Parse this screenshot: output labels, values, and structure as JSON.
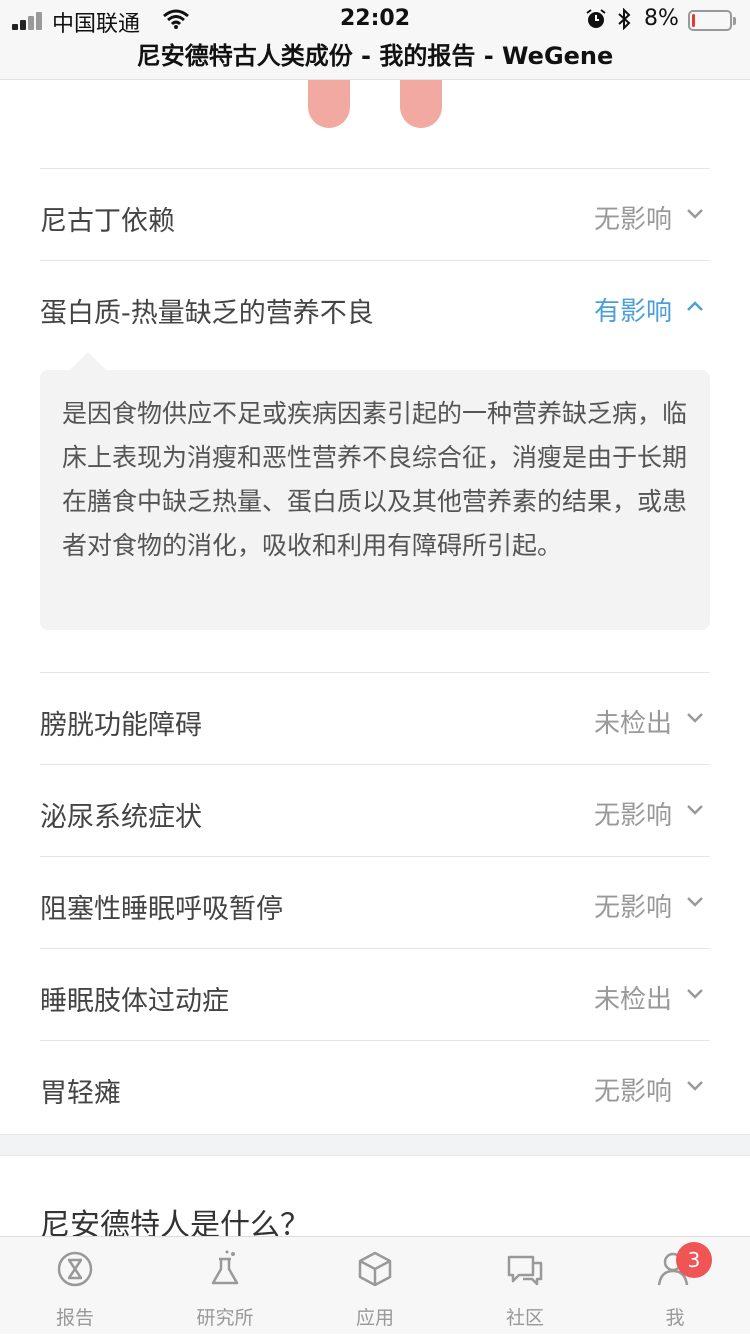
{
  "status_bar": {
    "carrier": "中国联通",
    "time": "22:02",
    "battery_percent": "8%",
    "battery_level": 0.08
  },
  "header": {
    "title": "尼安德特古人类成份 - 我的报告 - WeGene"
  },
  "items": [
    {
      "label": "尼古丁依赖",
      "status": "无影响",
      "expanded": false
    },
    {
      "label": "蛋白质-热量缺乏的营养不良",
      "status": "有影响",
      "expanded": true,
      "description": "是因食物供应不足或疾病因素引起的一种营养缺乏病，临床上表现为消瘦和恶性营养不良综合征，消瘦是由于长期在膳食中缺乏热量、蛋白质以及其他营养素的结果，或患者对食物的消化，吸收和利用有障碍所引起。"
    },
    {
      "label": "膀胱功能障碍",
      "status": "未检出",
      "expanded": false
    },
    {
      "label": "泌尿系统症状",
      "status": "无影响",
      "expanded": false
    },
    {
      "label": "阻塞性睡眠呼吸暂停",
      "status": "无影响",
      "expanded": false
    },
    {
      "label": "睡眠肢体过动症",
      "status": "未检出",
      "expanded": false
    },
    {
      "label": "胃轻瘫",
      "status": "无影响",
      "expanded": false
    }
  ],
  "section": {
    "title": "尼安德特人是什么？"
  },
  "tabbar": {
    "tabs": [
      {
        "label": "报告",
        "icon": "report-icon"
      },
      {
        "label": "研究所",
        "icon": "flask-icon"
      },
      {
        "label": "应用",
        "icon": "cube-icon"
      },
      {
        "label": "社区",
        "icon": "chat-icon"
      },
      {
        "label": "我",
        "icon": "person-icon"
      }
    ],
    "badge_count": "3"
  },
  "colors": {
    "accent": "#4a9fdb",
    "badge": "#f05454",
    "muted": "#999999",
    "foot": "#f1a9a1"
  }
}
